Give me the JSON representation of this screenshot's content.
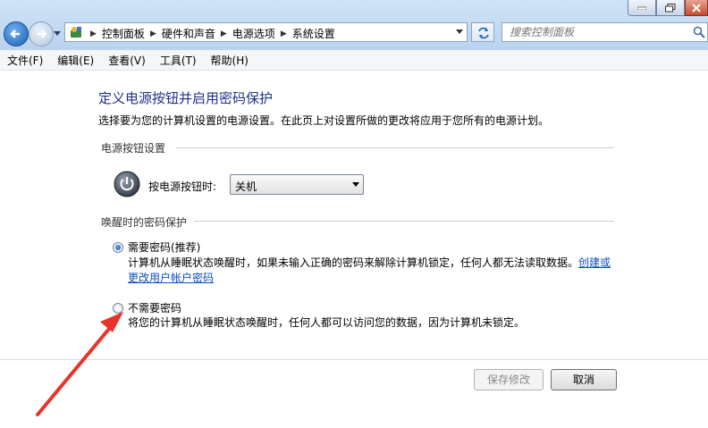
{
  "address": {
    "crumbs": [
      "控制面板",
      "硬件和声音",
      "电源选项",
      "系统设置"
    ]
  },
  "search": {
    "placeholder": "搜索控制面板"
  },
  "menu": [
    "文件(F)",
    "编辑(E)",
    "查看(V)",
    "工具(T)",
    "帮助(H)"
  ],
  "page": {
    "heading": "定义电源按钮并启用密码保护",
    "description": "选择要为您的计算机设置的电源设置。在此页上对设置所做的更改将应用于您所有的电源计划。"
  },
  "power_section": {
    "title": "电源按钮设置",
    "label": "按电源按钮时:",
    "selected": "关机"
  },
  "wake_section": {
    "title": "唤醒时的密码保护",
    "options": [
      {
        "label": "需要密码(推荐)",
        "desc": "计算机从睡眠状态唤醒时，如果未输入正确的密码来解除计算机锁定，任何人都无法读取数据。",
        "link": "创建或更改用户帐户密码",
        "checked": true
      },
      {
        "label": "不需要密码",
        "desc": "将您的计算机从睡眠状态唤醒时，任何人都可以访问您的数据，因为计算机未锁定。",
        "checked": false
      }
    ]
  },
  "buttons": {
    "save": "保存修改",
    "cancel": "取消"
  },
  "colors": {
    "heading": "#1e3287",
    "link": "#0b4fc4",
    "annotation_arrow": "#e8332a"
  }
}
